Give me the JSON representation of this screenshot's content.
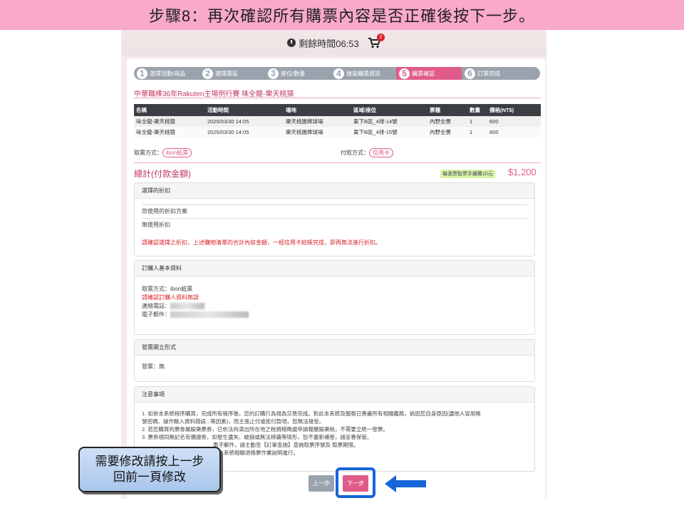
{
  "banner": {
    "text": "步驟8：再次確認所有購票內容是否正確後按下一步。"
  },
  "header": {
    "timer_text": "剩餘時間06:53",
    "cart_count": "2"
  },
  "steps": [
    {
      "num": "1",
      "label": "選擇活動/商品"
    },
    {
      "num": "2",
      "label": "選擇票區"
    },
    {
      "num": "3",
      "label": "座位/數量"
    },
    {
      "num": "4",
      "label": "填寫購票資訊"
    },
    {
      "num": "5",
      "label": "購票確認"
    },
    {
      "num": "6",
      "label": "訂票完成"
    }
  ],
  "event_title": "中華職棒36年Rakuten主場例行賽  味全龍-樂天桃猿",
  "orders": {
    "headers": [
      "名稱",
      "活動時間",
      "場地",
      "區域/座位",
      "票種",
      "數量",
      "價格(NT$)"
    ],
    "rows": [
      [
        "味全龍-樂天桃猿",
        "2025/03/30  14:05",
        "樂天桃園棒球場",
        "東下B區_4排-14號",
        "內野全票",
        "1",
        "600"
      ],
      [
        "味全龍-樂天桃猿",
        "2025/03/30  14:05",
        "樂天桃園棒球場",
        "東下B區_4排-15號",
        "內野全票",
        "1",
        "600"
      ]
    ]
  },
  "methods": {
    "pickup_label": "取票方式：",
    "pickup_value": "ibon紙票",
    "pay_label": "付款方式：",
    "pay_value": "信用卡"
  },
  "total": {
    "label": "總計(付款金額)",
    "fee_note": "每張票取票手續費10元",
    "amount": "$1,200"
  },
  "discount": {
    "title": "選擇的折扣",
    "used_label": "您使用的折扣方案",
    "used_value": "無使用折扣",
    "warning": "請確認選擇之折扣，上述購物清單的合計內容金額，一經信用卡結帳完成，即再無法進行折扣。"
  },
  "buyer": {
    "title": "訂購人基本資料",
    "pickup": "取票方式：ibon紙票",
    "confirm": "請確認訂購人資料無誤",
    "phone_label": "連絡電話：",
    "email_label": "電子郵件："
  },
  "invoice": {
    "title": "發票開立形式",
    "value": "發票：無"
  },
  "notes": {
    "title": "注意事項",
    "lines": [
      "1. 如依本系統程序購買，完成所有程序後，您的訂購行為視為交易完成。對此本系統及服務已善盡所有相關義務，倘因您自身原因(遺他人冒用帳",
      "號密碼、操作輸入資料錯誤...等因素)，而主張止付或拒付款項，恕無法接受。",
      "2. 若您購買的票券屬娛樂票券，已依法向演出所在地之稅捐稽徵處申請報繳娛樂稅，不需要立統一發票。",
      "3. 票券視同無記名有價證券，如發生遺失、破損或無法辨識等情形，恕不重新補發，請妥善保管。",
      "電子郵件，請主動至【訂單查詢】查詢取票序號及 取票期限。",
      "照本系統相關退換票作業說明進行。"
    ]
  },
  "buttons": {
    "prev": "上一步",
    "next": "下一步"
  },
  "callout": {
    "line1": "需要修改請按上一步",
    "line2": "回前一頁修改"
  }
}
